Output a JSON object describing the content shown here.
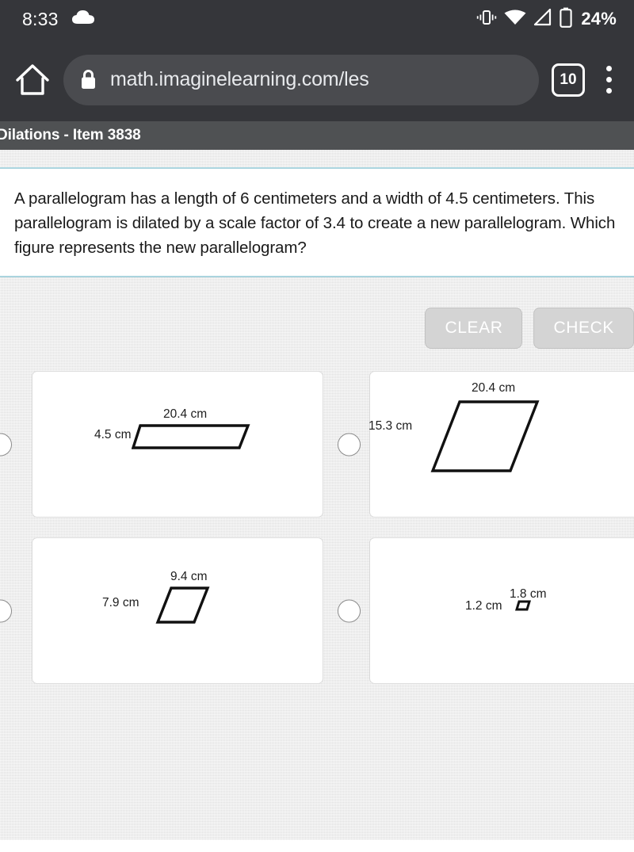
{
  "status_bar": {
    "clock": "8:33",
    "weather_icon": "cloud-icon",
    "vibrate_icon": "vibrate-icon",
    "wifi_icon": "wifi-icon",
    "signal_icon": "cell-signal-icon",
    "battery_icon": "battery-icon",
    "battery_percent": "24%"
  },
  "browser": {
    "home_icon": "home-icon",
    "lock_icon": "lock-icon",
    "url": "math.imaginelearning.com/les",
    "tab_count": "10",
    "menu_icon": "overflow-menu-icon"
  },
  "app": {
    "title": "Dilations - Item 3838"
  },
  "question": {
    "text": "A parallelogram has a length of 6 centimeters and a width of 4.5 centimeters. This parallelogram is dilated by a scale factor of 3.4 to create a new parallelogram. Which figure represents the new parallelogram?"
  },
  "toolbar": {
    "clear_label": "CLEAR",
    "check_label": "CHECK"
  },
  "colors": {
    "chrome": "#35363a",
    "titlebar": "#4f5153",
    "rule": "#aad4de",
    "page_bg": "#e9e9e9",
    "card_bg": "#ffffff",
    "button_bg": "#d4d4d4"
  },
  "choices": [
    {
      "id": "a",
      "length_label": "20.4 cm",
      "width_label": "4.5 cm",
      "selected": false,
      "shape": "parallelogram"
    },
    {
      "id": "b",
      "length_label": "20.4 cm",
      "width_label": "15.3 cm",
      "selected": false,
      "shape": "parallelogram"
    },
    {
      "id": "c",
      "length_label": "9.4 cm",
      "width_label": "7.9 cm",
      "selected": false,
      "shape": "parallelogram"
    },
    {
      "id": "d",
      "length_label": "1.8 cm",
      "width_label": "1.2 cm",
      "selected": false,
      "shape": "parallelogram"
    }
  ]
}
